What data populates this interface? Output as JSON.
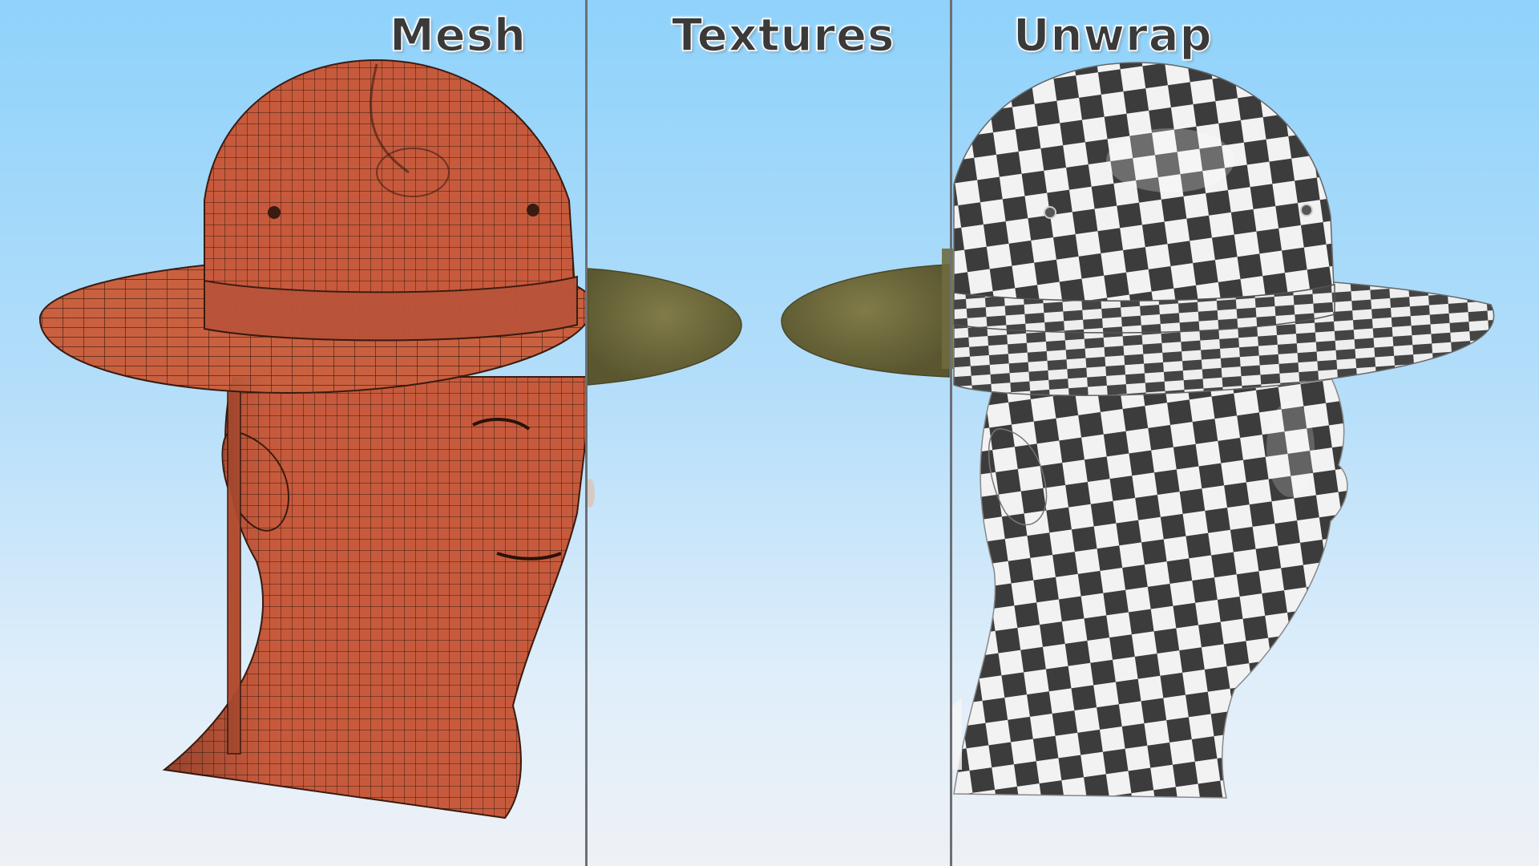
{
  "panels": [
    {
      "id": "mesh",
      "label": "Mesh"
    },
    {
      "id": "textures",
      "label": "Textures"
    },
    {
      "id": "unwrap",
      "label": "Unwrap"
    }
  ],
  "colors": {
    "sky_top": "#8fd2fb",
    "sky_bottom": "#eef1f6",
    "mesh_fill": "#c75a3c",
    "mesh_wire": "#3a1b10",
    "hat_felt": "#6f6b3c",
    "checker_dark": "#3c3c3c",
    "checker_light": "#f2f2f2",
    "divider": "#6d6f74"
  }
}
